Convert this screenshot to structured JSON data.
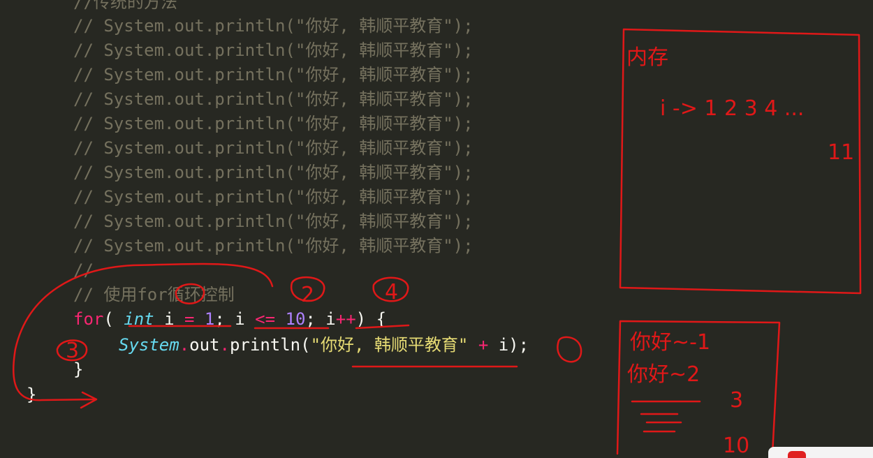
{
  "code": {
    "cut_comment": "//传统的方法",
    "comment_lines": [
      "// System.out.println(\"你好, 韩顺平教育\");",
      "// System.out.println(\"你好, 韩顺平教育\");",
      "// System.out.println(\"你好, 韩顺平教育\");",
      "// System.out.println(\"你好, 韩顺平教育\");",
      "// System.out.println(\"你好, 韩顺平教育\");",
      "// System.out.println(\"你好, 韩顺平教育\");",
      "// System.out.println(\"你好, 韩顺平教育\");",
      "// System.out.println(\"你好, 韩顺平教育\");",
      "// System.out.println(\"你好, 韩顺平教育\");",
      "// System.out.println(\"你好, 韩顺平教育\");"
    ],
    "empty_comment": "//",
    "for_comment": "// 使用for循环控制",
    "for_line": {
      "kw_for": "for",
      "open": "( ",
      "type_int": "int",
      "var_i1": " i ",
      "op_assign": "=",
      "sp1": " ",
      "num_1": "1",
      "semi1": "; i ",
      "op_le": "<=",
      "sp2": " ",
      "num_10": "10",
      "semi2": "; i",
      "op_inc": "++",
      "close": ") {"
    },
    "print_line": {
      "sys": "System",
      "dot1": ".",
      "out": "out",
      "dot2": ".",
      "println": "println(",
      "string": "\"你好, 韩顺平教育\"",
      "sp": " ",
      "op_plus": "+",
      "arg": " i);"
    },
    "close_inner": "}",
    "close_outer": "}"
  },
  "annotations": {
    "memory_label": "内存",
    "memory_seq": "i -> 1 2 3 4 ...",
    "memory_end": "11",
    "step_2": "2",
    "step_3": "3",
    "step_4": "4",
    "output_1": "你好~-1",
    "output_2": "你好~2",
    "output_3": "3",
    "output_10": "10"
  },
  "colors": {
    "background": "#272822",
    "comment": "#75715e",
    "keyword": "#f92672",
    "type": "#66d9ef",
    "number": "#ae81ff",
    "string": "#e6db74",
    "ink": "#e01818"
  }
}
